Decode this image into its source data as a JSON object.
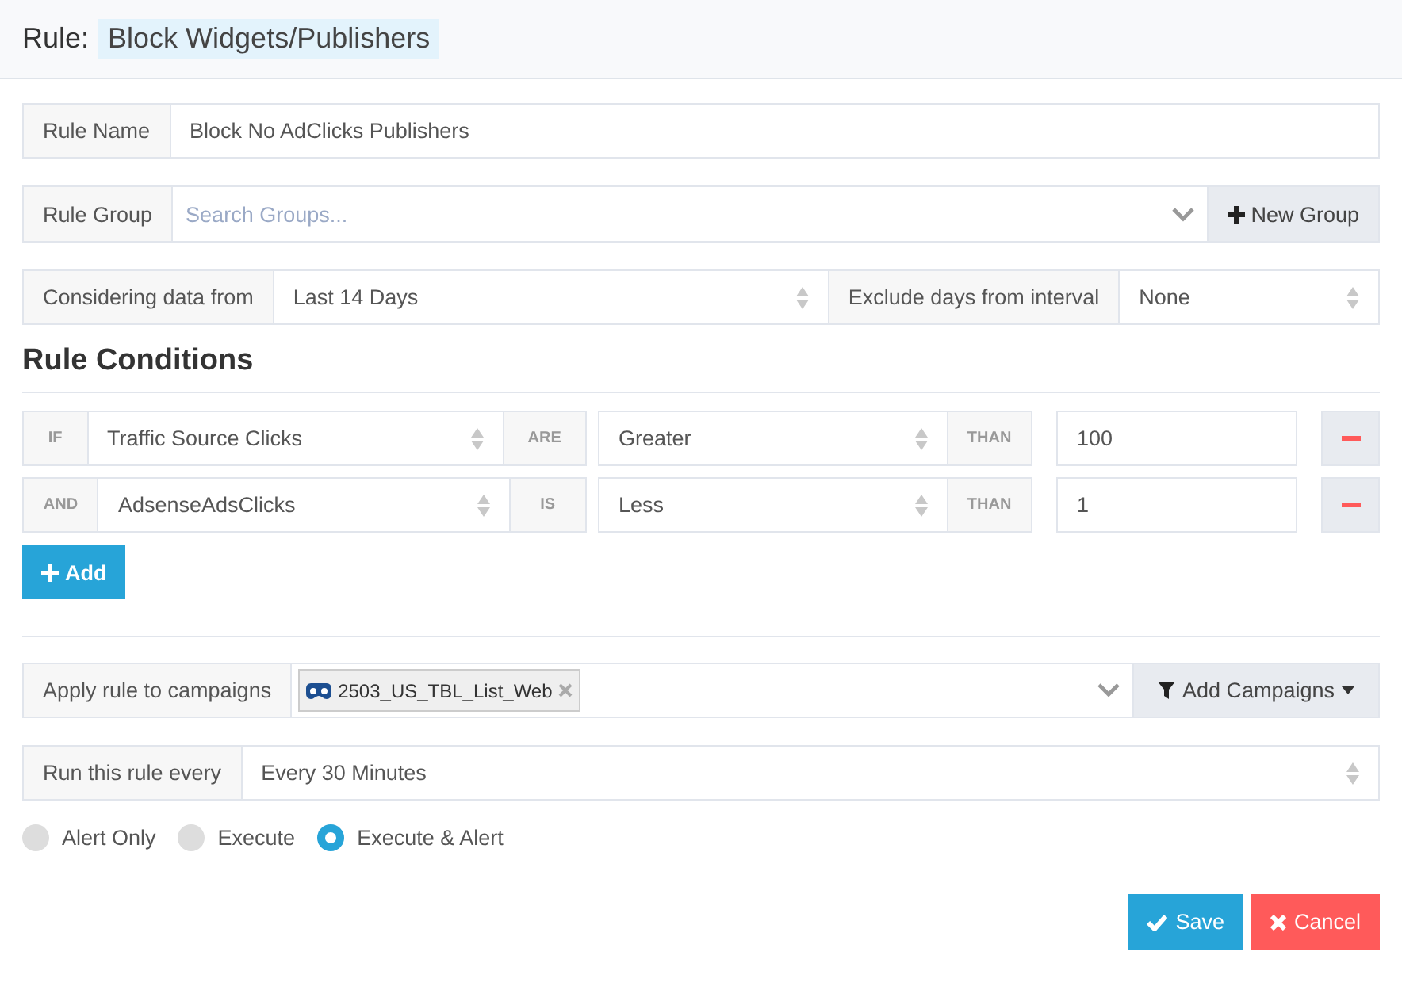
{
  "header": {
    "label": "Rule:",
    "title": "Block Widgets/Publishers"
  },
  "rule_name": {
    "label": "Rule Name",
    "value": "Block No AdClicks Publishers"
  },
  "rule_group": {
    "label": "Rule Group",
    "placeholder": "Search Groups...",
    "button": "New Group"
  },
  "data_range": {
    "label": "Considering data from",
    "value": "Last 14 Days",
    "exclude_label": "Exclude days from interval",
    "exclude_value": "None"
  },
  "conditions": {
    "title": "Rule Conditions",
    "rows": [
      {
        "connector": "IF",
        "metric": "Traffic Source Clicks",
        "verb": "ARE",
        "operator": "Greater",
        "comparator": "THAN",
        "value": "100"
      },
      {
        "connector": "AND",
        "metric": "AdsenseAdsClicks",
        "verb": "IS",
        "operator": "Less",
        "comparator": "THAN",
        "value": "1"
      }
    ],
    "add_button": "Add"
  },
  "campaigns": {
    "label": "Apply rule to campaigns",
    "tags": [
      {
        "text": "2503_US_TBL_List_Web"
      }
    ],
    "button": "Add Campaigns"
  },
  "schedule": {
    "label": "Run this rule every",
    "value": "Every 30 Minutes"
  },
  "actions": [
    {
      "label": "Alert Only",
      "selected": false
    },
    {
      "label": "Execute",
      "selected": false
    },
    {
      "label": "Execute & Alert",
      "selected": true
    }
  ],
  "buttons": [
    {
      "kind": "save",
      "label": "Save"
    },
    {
      "kind": "cancel",
      "label": "Cancel"
    }
  ]
}
